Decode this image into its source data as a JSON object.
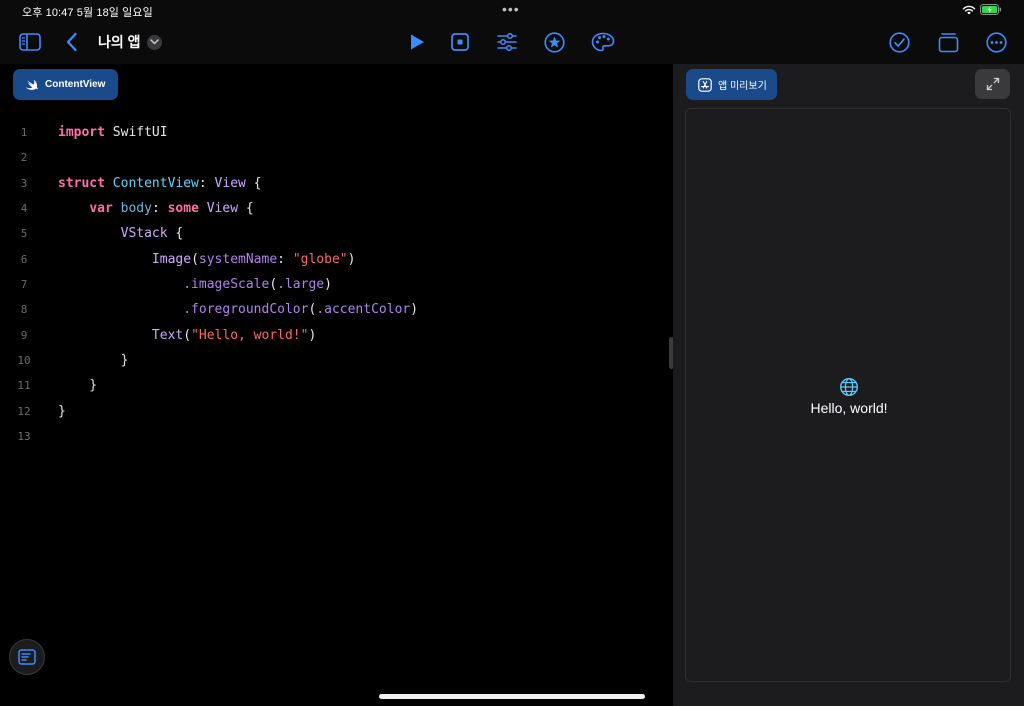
{
  "status_bar": {
    "time": "오후 10:47   5월 18일 일요일",
    "dots": "•••",
    "wifi_icon": "wifi-icon",
    "battery_icon": "battery-charging-icon"
  },
  "toolbar": {
    "title": "나의 앱",
    "icons": {
      "sidebar": "sidebar-icon",
      "back": "chevron-left-icon",
      "run": "play-icon",
      "stop": "stop-icon",
      "settings": "sliders-icon",
      "favorite": "star-circle-icon",
      "palette": "palette-icon",
      "check": "checkmark-circle-icon",
      "windows": "windows-icon",
      "more": "ellipsis-circle-icon"
    },
    "accent_color": "#3d8bff"
  },
  "editor": {
    "file_tab_label": "ContentView",
    "lines": [
      "1",
      "2",
      "3",
      "4",
      "5",
      "6",
      "7",
      "8",
      "9",
      "10",
      "11",
      "12",
      "13"
    ],
    "code": {
      "l1_kw": "import",
      "l1_rest": " SwiftUI",
      "l3_kw": "struct",
      "l3_name": " ContentView",
      "l3_colon": ": ",
      "l3_type": "View",
      "l3_brace": " {",
      "l4_indent": "    ",
      "l4_kw": "var",
      "l4_name": " body",
      "l4_colon": ": ",
      "l4_kw2": "some",
      "l4_type": " View",
      "l4_brace": " {",
      "l5_indent": "        ",
      "l5_type": "VStack",
      "l5_brace": " {",
      "l6_indent": "            ",
      "l6_type": "Image",
      "l6_open": "(",
      "l6_param": "systemName",
      "l6_colon": ": ",
      "l6_str": "\"globe\"",
      "l6_close": ")",
      "l7_indent": "                ",
      "l7_fn": ".imageScale",
      "l7_open": "(",
      "l7_arg": ".large",
      "l7_close": ")",
      "l8_indent": "                ",
      "l8_fn": ".foregroundColor",
      "l8_open": "(",
      "l8_arg": ".accentColor",
      "l8_close": ")",
      "l9_indent": "            ",
      "l9_type": "Text",
      "l9_open": "(",
      "l9_str": "\"Hello, world!\"",
      "l9_close": ")",
      "l10": "        }",
      "l11": "    }",
      "l12": "}"
    },
    "outline_icon": "outline-icon"
  },
  "preview": {
    "tab_label": "앱 미리보기",
    "tab_icon": "app-store-icon",
    "expand_icon": "expand-arrows-icon",
    "globe_icon": "globe-icon",
    "hello_text": "Hello, world!"
  }
}
